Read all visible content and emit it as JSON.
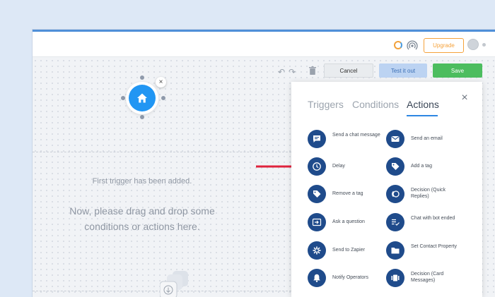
{
  "topbar": {
    "upgrade_label": "Upgrade",
    "icons": [
      "loader-icon",
      "signal-icon",
      "avatar",
      "status-dot"
    ]
  },
  "toolbar": {
    "undo_icon": "↶",
    "redo_icon": "↷",
    "cancel_label": "Cancel",
    "test_label": "Test it out",
    "save_label": "Save"
  },
  "canvas": {
    "remove_symbol": "×",
    "first_trigger_text": "First trigger has been added.",
    "instruction_text": "Now, please drag and drop some conditions or actions here."
  },
  "panel": {
    "tabs": [
      {
        "label": "Triggers",
        "active": false
      },
      {
        "label": "Conditions",
        "active": false
      },
      {
        "label": "Actions",
        "active": true
      }
    ],
    "close_symbol": "×",
    "actions": [
      {
        "label": "Send a chat message",
        "icon": "chat-icon"
      },
      {
        "label": "Send an email",
        "icon": "email-icon"
      },
      {
        "label": "Delay",
        "icon": "clock-icon"
      },
      {
        "label": "Add a tag",
        "icon": "tag-icon"
      },
      {
        "label": "Remove a tag",
        "icon": "tag-icon"
      },
      {
        "label": "Decision (Quick Replies)",
        "icon": "decision-icon"
      },
      {
        "label": "Ask a question",
        "icon": "input-icon"
      },
      {
        "label": "Chat with bot ended",
        "icon": "chat-ended-icon"
      },
      {
        "label": "Send to Zapier",
        "icon": "zapier-icon"
      },
      {
        "label": "Set Contact Property",
        "icon": "folder-icon"
      },
      {
        "label": "Notify Operators",
        "icon": "bell-icon"
      },
      {
        "label": "Decision (Card Messages)",
        "icon": "cards-icon"
      }
    ]
  },
  "colors": {
    "primary": "#2196f3",
    "action_icon_bg": "#1f4b8b",
    "save_green": "#4cbd5f",
    "upgrade_orange": "#f5a23b",
    "arrow_red": "#e0233d"
  }
}
